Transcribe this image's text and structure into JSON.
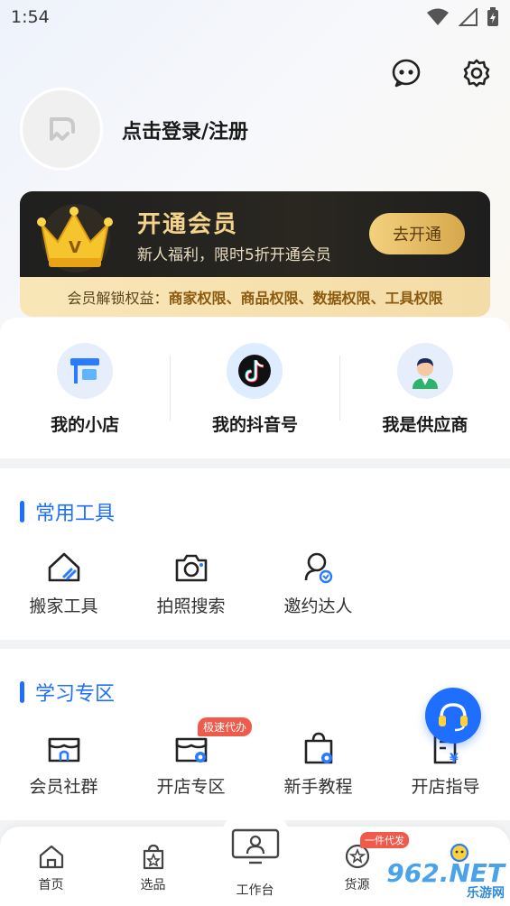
{
  "status": {
    "time": "1:54"
  },
  "header": {
    "login_text": "点击登录/注册"
  },
  "vip": {
    "title": "开通会员",
    "subtitle": "新人福利，限时5折开通会员",
    "button": "去开通",
    "benefits_label": "会员解锁权益：",
    "benefits_value": "商家权限、商品权限、数据权限、工具权限"
  },
  "shortcuts": [
    {
      "label": "我的小店",
      "icon": "store-icon"
    },
    {
      "label": "我的抖音号",
      "icon": "douyin-icon"
    },
    {
      "label": "我是供应商",
      "icon": "supplier-icon"
    }
  ],
  "common_tools": {
    "title": "常用工具",
    "items": [
      {
        "label": "搬家工具",
        "icon": "house-link-icon"
      },
      {
        "label": "拍照搜索",
        "icon": "camera-icon"
      },
      {
        "label": "邀约达人",
        "icon": "invite-person-icon"
      }
    ]
  },
  "learning": {
    "title": "学习专区",
    "items": [
      {
        "label": "会员社群",
        "icon": "shop-community-icon",
        "tag": ""
      },
      {
        "label": "开店专区",
        "icon": "shop-gear-icon",
        "tag": "极速代办"
      },
      {
        "label": "新手教程",
        "icon": "bag-gear-icon",
        "tag": ""
      },
      {
        "label": "开店指导",
        "icon": "guide-doc-icon",
        "tag": ""
      }
    ]
  },
  "tabbar": {
    "items": [
      {
        "label": "首页",
        "icon": "home-icon"
      },
      {
        "label": "选品",
        "icon": "bag-star-icon"
      },
      {
        "label": "工作台",
        "icon": "monitor-person-icon"
      },
      {
        "label": "货源",
        "icon": "star-chat-icon",
        "badge": "一件代发"
      },
      {
        "label": "",
        "icon": "profile-icon"
      }
    ]
  },
  "watermark": {
    "line1": "962.NET",
    "line2": "乐游网"
  },
  "colors": {
    "accent": "#1e6fff",
    "gold": "#f3d38b",
    "badge": "#f05a4a"
  }
}
